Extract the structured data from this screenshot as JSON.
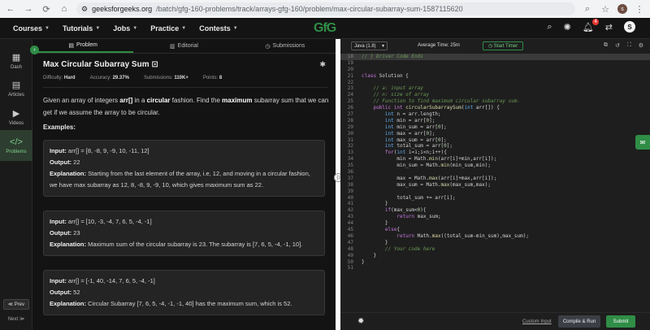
{
  "browser": {
    "back": "←",
    "forward": "→",
    "reload": "⟳",
    "home": "⌂",
    "url_host": "geeksforgeeks.org",
    "url_path": "/batch/gfg-160-problems/track/arrays-gfg-160/problem/max-circular-subarray-sum-1587115620",
    "profile": "s"
  },
  "nav": {
    "items": [
      "Courses",
      "Tutorials",
      "Jobs",
      "Practice",
      "Contests"
    ],
    "logo": "GfG",
    "notif_count": "4",
    "user_initial": "S"
  },
  "rail": {
    "items": [
      {
        "label": "Dash",
        "icon": "▦"
      },
      {
        "label": "Articles",
        "icon": "▤"
      },
      {
        "label": "Videos",
        "icon": "▶"
      },
      {
        "label": "Problems",
        "icon": "</>"
      }
    ],
    "prev": "≪ Prev",
    "next": "Next ≫"
  },
  "tabs": [
    "Problem",
    "Editorial",
    "Submissions"
  ],
  "problem": {
    "title": "Max Circular Subarray Sum",
    "difficulty_label": "Difficulty:",
    "difficulty": "Hard",
    "accuracy_label": "Accuracy:",
    "accuracy": "29.37%",
    "submissions_label": "Submissions:",
    "submissions": "110K+",
    "points_label": "Points:",
    "points": "8",
    "desc_1": "Given an array of integers ",
    "desc_2": "arr[]",
    "desc_3": " in a ",
    "desc_4": "circular",
    "desc_5": " fashion. Find the ",
    "desc_6": "maximum",
    "desc_7": " subarray sum that we can get if we assume the array to be circular.",
    "examples_heading": "Examples:",
    "input_label": "Input:",
    "output_label": "Output:",
    "explanation_label": "Explanation:",
    "examples": [
      {
        "input": "arr[] = [8, -8, 9, -9, 10, -11, 12]",
        "output": "22",
        "explanation": "Starting from the last element of the array, i.e, 12, and moving in a circular fashion, we have max subarray as 12, 8, -8, 9, -9, 10, which gives maximum sum as 22."
      },
      {
        "input": "arr[] = [10, -3, -4, 7, 6, 5, -4, -1]",
        "output": "23",
        "explanation": "Maximum sum of the circular subarray is 23. The subarray is [7, 6, 5, -4, -1, 10]."
      },
      {
        "input": "arr[] = [-1, 40, -14, 7, 6, 5, -4, -1]",
        "output": "52",
        "explanation": "Circular Subarray [7, 6, 5, -4, -1, -1, 40] has the maximum sum, which is 52."
      }
    ]
  },
  "editor": {
    "language": "Java (1.8)",
    "avg_time": "Average Time: 25m",
    "timer": "Start Timer",
    "custom_input": "Custom Input",
    "compile": "Compile & Run",
    "submit": "Submit",
    "lines": [
      {
        "n": "18",
        "html": "<span class=\"cm\">// } Driver Code Ends</span>"
      },
      {
        "n": "19",
        "html": ""
      },
      {
        "n": "20",
        "html": ""
      },
      {
        "n": "21",
        "html": "<span class=\"kw\">class</span> Solution {"
      },
      {
        "n": "22",
        "html": ""
      },
      {
        "n": "23",
        "html": "    <span class=\"cm\">// a: input array</span>"
      },
      {
        "n": "24",
        "html": "    <span class=\"cm\">// n: size of array</span>"
      },
      {
        "n": "25",
        "html": "    <span class=\"cm\">// Function to find maximum circular subarray sum.</span>"
      },
      {
        "n": "26",
        "html": "    <span class=\"kw\">public int</span> <span class=\"fn\">circularSubarraySum</span>(<span class=\"ty\">int</span> arr[]) {"
      },
      {
        "n": "27",
        "html": "        <span class=\"ty\">int</span> n = arr.length;"
      },
      {
        "n": "28",
        "html": "        <span class=\"ty\">int</span> min = arr[<span class=\"nm\">0</span>];"
      },
      {
        "n": "29",
        "html": "        <span class=\"ty\">int</span> min_sum = arr[<span class=\"nm\">0</span>];"
      },
      {
        "n": "30",
        "html": "        <span class=\"ty\">int</span> max = arr[<span class=\"nm\">0</span>];"
      },
      {
        "n": "31",
        "html": "        <span class=\"ty\">int</span> max_sum = arr[<span class=\"nm\">0</span>];"
      },
      {
        "n": "32",
        "html": "        <span class=\"ty\">int</span> total_sum = arr[<span class=\"nm\">0</span>];"
      },
      {
        "n": "33",
        "html": "        <span class=\"kw\">for</span>(<span class=\"ty\">int</span> i=<span class=\"nm\">1</span>;i&lt;n;i++){"
      },
      {
        "n": "34",
        "html": "            min = Math.<span class=\"fn\">min</span>(arr[i]+min,arr[i]);"
      },
      {
        "n": "35",
        "html": "            min_sum = Math.<span class=\"fn\">min</span>(min_sum,min);"
      },
      {
        "n": "36",
        "html": ""
      },
      {
        "n": "37",
        "html": "            max = Math.<span class=\"fn\">max</span>(arr[i]+max,arr[i]);"
      },
      {
        "n": "38",
        "html": "            max_sum = Math.<span class=\"fn\">max</span>(max_sum,max);"
      },
      {
        "n": "39",
        "html": ""
      },
      {
        "n": "40",
        "html": "            total_sum += arr[i];"
      },
      {
        "n": "41",
        "html": "        }"
      },
      {
        "n": "42",
        "html": "        <span class=\"kw\">if</span>(max_sum&lt;<span class=\"nm\">0</span>){"
      },
      {
        "n": "43",
        "html": "            <span class=\"kw\">return</span> max_sum;"
      },
      {
        "n": "44",
        "html": "        }"
      },
      {
        "n": "45",
        "html": "        <span class=\"kw\">else</span>{"
      },
      {
        "n": "46",
        "html": "            <span class=\"kw\">return</span> Math.<span class=\"fn\">max</span>((total_sum-min_sum),max_sum);"
      },
      {
        "n": "47",
        "html": "        }"
      },
      {
        "n": "48",
        "html": "        <span class=\"cm\">// Your code here</span>"
      },
      {
        "n": "49",
        "html": "    }"
      },
      {
        "n": "50",
        "html": "}"
      },
      {
        "n": "51",
        "html": ""
      }
    ]
  }
}
